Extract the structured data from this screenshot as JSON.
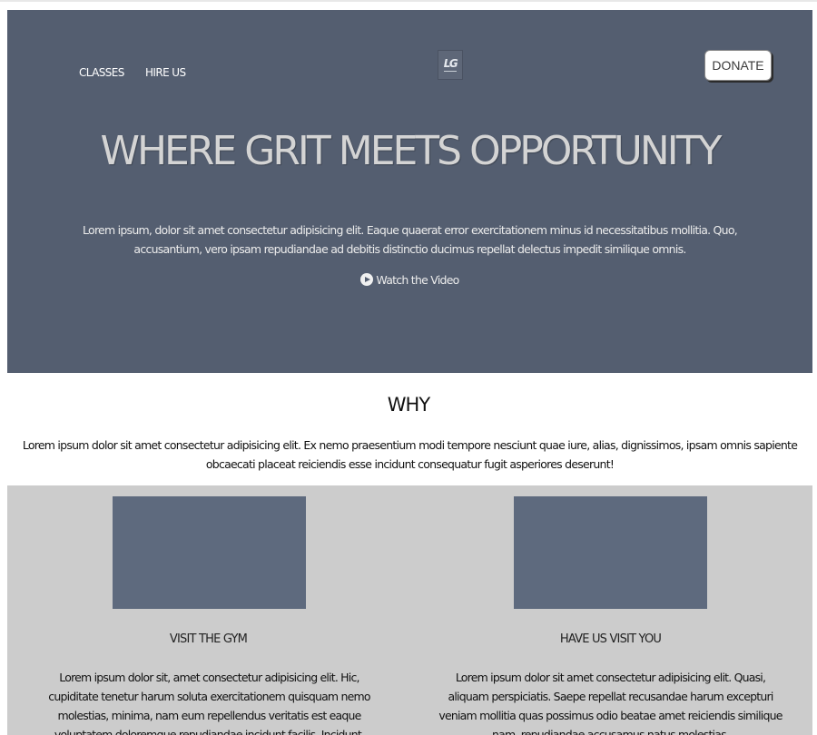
{
  "nav": {
    "links": [
      "CLASSES",
      "HIRE US"
    ],
    "logo_text": "LG",
    "donate_label": "DONATE"
  },
  "hero": {
    "title": "WHERE GRIT MEETS OPPORTUNITY",
    "description": "Lorem ipsum, dolor sit amet consectetur adipisicing elit. Eaque quaerat error exercitationem minus id necessitatibus mollitia. Quo, accusantium, vero ipsam repudiandae ad debitis distinctio ducimus repellat delectus impedit similique omnis.",
    "video_label": "Watch the Video",
    "video_icon": "play-circle-icon"
  },
  "why": {
    "title": "WHY",
    "description": "Lorem ipsum dolor sit amet consectetur adipisicing elit. Ex nemo praesentium modi tempore nesciunt quae iure, alias, dignissimos, ipsam omnis sapiente obcaecati placeat reiciendis esse incidunt consequatur fugit asperiores deserunt!"
  },
  "cards": [
    {
      "title": "VISIT THE GYM",
      "text": "Lorem ipsum dolor sit, amet consectetur adipisicing elit. Hic, cupiditate tenetur harum soluta exercitationem quisquam nemo molestias, minima, nam eum repellendus veritatis est eaque voluptatem doloremque repudiandae incidunt facilis. Incidunt."
    },
    {
      "title": "HAVE US VISIT YOU",
      "text": "Lorem ipsum dolor sit amet consectetur adipisicing elit. Quasi, aliquam perspiciatis. Saepe repellat recusandae harum excepturi veniam mollitia quas possimus odio beatae amet reiciendis similique nam, repudiandae accusamus natus molestias."
    }
  ],
  "colors": {
    "hero_bg": "#545e70",
    "card_section_bg": "#cccccc",
    "card_image": "#5e6a7e",
    "title_text": "#d4d4d4"
  }
}
